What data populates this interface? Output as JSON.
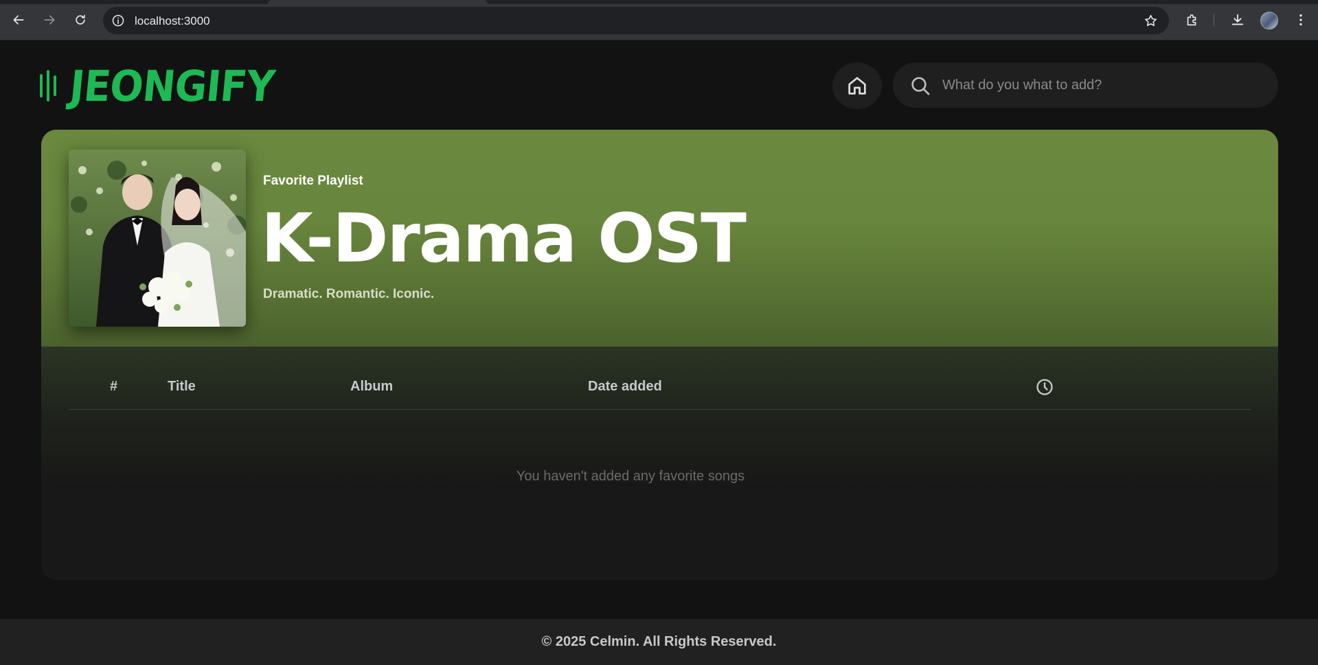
{
  "browser": {
    "url": "localhost:3000",
    "back_icon": "arrow-left-icon",
    "forward_icon": "arrow-right-icon",
    "reload_icon": "reload-icon"
  },
  "app": {
    "logo_text": "JEONGIFY",
    "brand_color": "#1db954",
    "search": {
      "placeholder": "What do you what to add?",
      "value": ""
    }
  },
  "playlist": {
    "type_label": "Favorite Playlist",
    "title": "K-Drama OST",
    "description": "Dramatic. Romantic. Iconic.",
    "hero_color": "#6a883e"
  },
  "table": {
    "columns": {
      "index": "#",
      "title": "Title",
      "album": "Album",
      "date_added": "Date added",
      "duration_icon": "clock-icon"
    },
    "rows": [],
    "empty_message": "You haven't added any favorite songs"
  },
  "footer": {
    "text": "© 2025 Celmin. All Rights Reserved."
  }
}
